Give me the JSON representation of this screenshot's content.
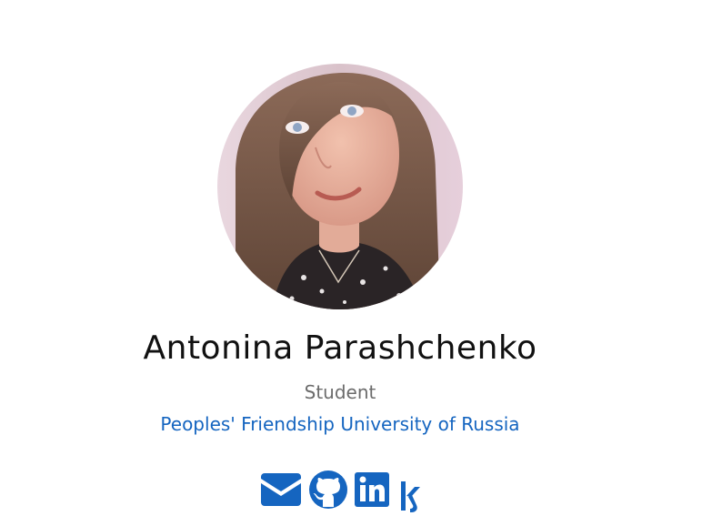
{
  "profile": {
    "name": "Antonina Parashchenko",
    "role": "Student",
    "organization": "Peoples' Friendship University of Russia",
    "avatar_alt": "Profile photo of Antonina Parashchenko"
  },
  "social": [
    {
      "icon": "envelope-icon"
    },
    {
      "icon": "github-icon"
    },
    {
      "icon": "linkedin-icon"
    },
    {
      "icon": "kaggle-icon"
    }
  ],
  "colors": {
    "accent": "#1565c0",
    "name": "#111111",
    "role": "#6c6c6c",
    "background": "#ffffff"
  }
}
